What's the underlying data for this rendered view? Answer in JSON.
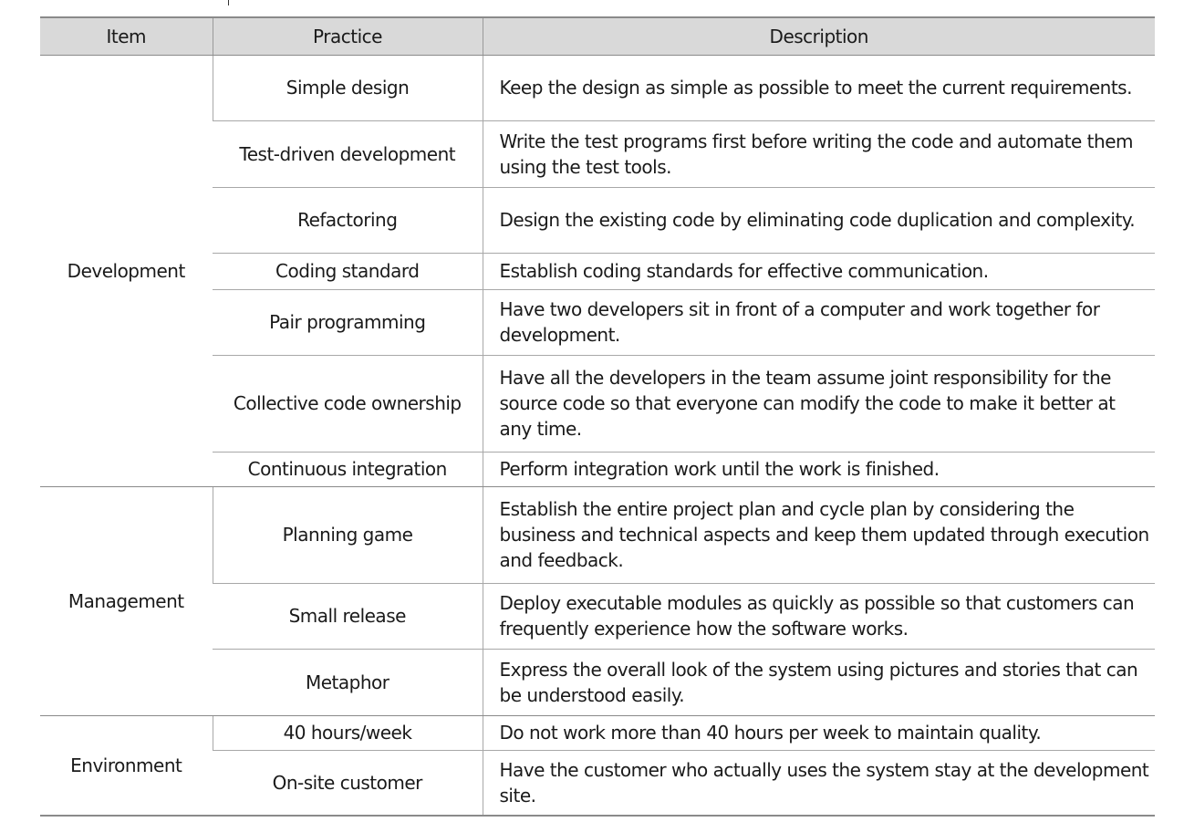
{
  "table": {
    "headers": {
      "item": "Item",
      "practice": "Practice",
      "description": "Description"
    },
    "groups": [
      {
        "item": "Development",
        "rows": [
          {
            "practice": "Simple design",
            "description": "Keep the design as simple as possible to meet the current requirements."
          },
          {
            "practice": "Test-driven development",
            "description": "Write the test programs first before writing the code and automate them using the test tools."
          },
          {
            "practice": "Refactoring",
            "description": "Design the existing code by eliminating code duplication and complexity."
          },
          {
            "practice": "Coding standard",
            "description": "Establish coding standards for effective communication."
          },
          {
            "practice": "Pair programming",
            "description": "Have two developers sit in front of a computer and work together for development."
          },
          {
            "practice": "Collective code ownership",
            "description": "Have all the developers in the team assume joint responsibility for the source code so that everyone can modify the code to make it better at any time."
          },
          {
            "practice": "Continuous integration",
            "description": "Perform integration work until the work is finished."
          }
        ]
      },
      {
        "item": "Management",
        "rows": [
          {
            "practice": "Planning game",
            "description": "Establish the entire project plan and cycle plan by considering the business and technical aspects and keep them updated through execution and feedback."
          },
          {
            "practice": "Small release",
            "description": "Deploy executable modules as quickly as possible so that customers can frequently experience how the software works."
          },
          {
            "practice": "Metaphor",
            "description": "Express the overall look of the system using pictures and stories that can be understood easily."
          }
        ]
      },
      {
        "item": "Environment",
        "rows": [
          {
            "practice": "40 hours/week",
            "description": "Do not work more than 40 hours per week to maintain quality."
          },
          {
            "practice": "On-site customer",
            "description": "Have the customer who actually uses the system stay at the development site."
          }
        ]
      }
    ]
  }
}
